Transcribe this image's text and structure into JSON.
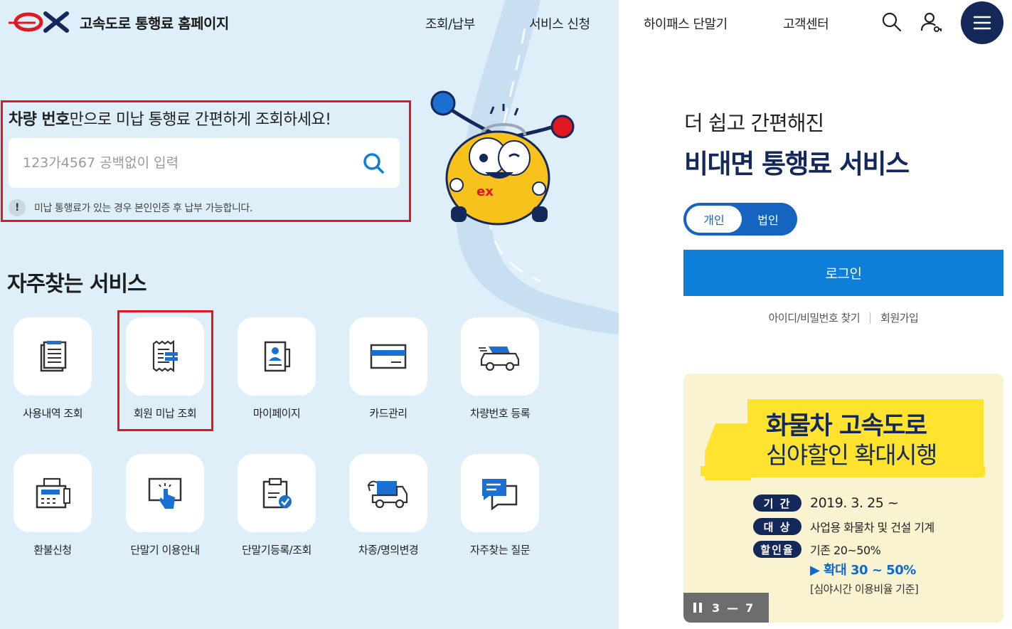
{
  "header": {
    "logo_text": "ex",
    "title": "고속도로 통행료 홈페이지",
    "nav": [
      "조회/납부",
      "서비스 신청",
      "하이패스 단말기",
      "고객센터"
    ]
  },
  "search": {
    "heading_bold": "차량 번호",
    "heading_rest": "만으로 미납 통행료 간편하게 조회하세요!",
    "placeholder": "123가4567 공백없이 입력",
    "notice": "미납 통행료가 있는 경우 본인인증 후 납부 가능합니다."
  },
  "services": {
    "title": "자주찾는 서비스",
    "items": [
      {
        "label": "사용내역 조회",
        "icon": "document-list-icon"
      },
      {
        "label": "회원 미납 조회",
        "icon": "receipt-icon"
      },
      {
        "label": "마이페이지",
        "icon": "profile-book-icon"
      },
      {
        "label": "카드관리",
        "icon": "card-icon"
      },
      {
        "label": "차량번호 등록",
        "icon": "car-icon"
      },
      {
        "label": "환불신청",
        "icon": "fax-icon"
      },
      {
        "label": "단말기 이용안내",
        "icon": "touch-screen-icon"
      },
      {
        "label": "단말기등록/조회",
        "icon": "clipboard-check-icon"
      },
      {
        "label": "차종/명의변경",
        "icon": "truck-icon"
      },
      {
        "label": "자주찾는 질문",
        "icon": "chat-icon"
      }
    ]
  },
  "login": {
    "subtitle": "더 쉽고 간편해진",
    "title": "비대면 통행료 서비스",
    "toggle_personal": "개인",
    "toggle_corporate": "법인",
    "login_button": "로그인",
    "find_account": "아이디/비밀번호 찾기",
    "signup": "회원가입"
  },
  "banner": {
    "title_line1": "화물차 고속도로",
    "title_line2": "심야할인 확대시행",
    "period_label": "기 간",
    "period_value": "2019. 3. 25 ~",
    "target_label": "대 상",
    "target_value": "사업용 화물차 및 건설 기계",
    "rate_label": "할인율",
    "rate_value": "기존 20~50%",
    "expanded": "확대 30 ~ 50%",
    "footnote": "[심야시간 이용비율 기준]",
    "pager_current": "3",
    "pager_sep": "—",
    "pager_total": "7"
  },
  "colors": {
    "brand_red": "#e0181f",
    "navy": "#14285a",
    "blue": "#0e7fd9",
    "panel_bg": "#deeffa",
    "banner_yellow": "#ffe32f"
  }
}
